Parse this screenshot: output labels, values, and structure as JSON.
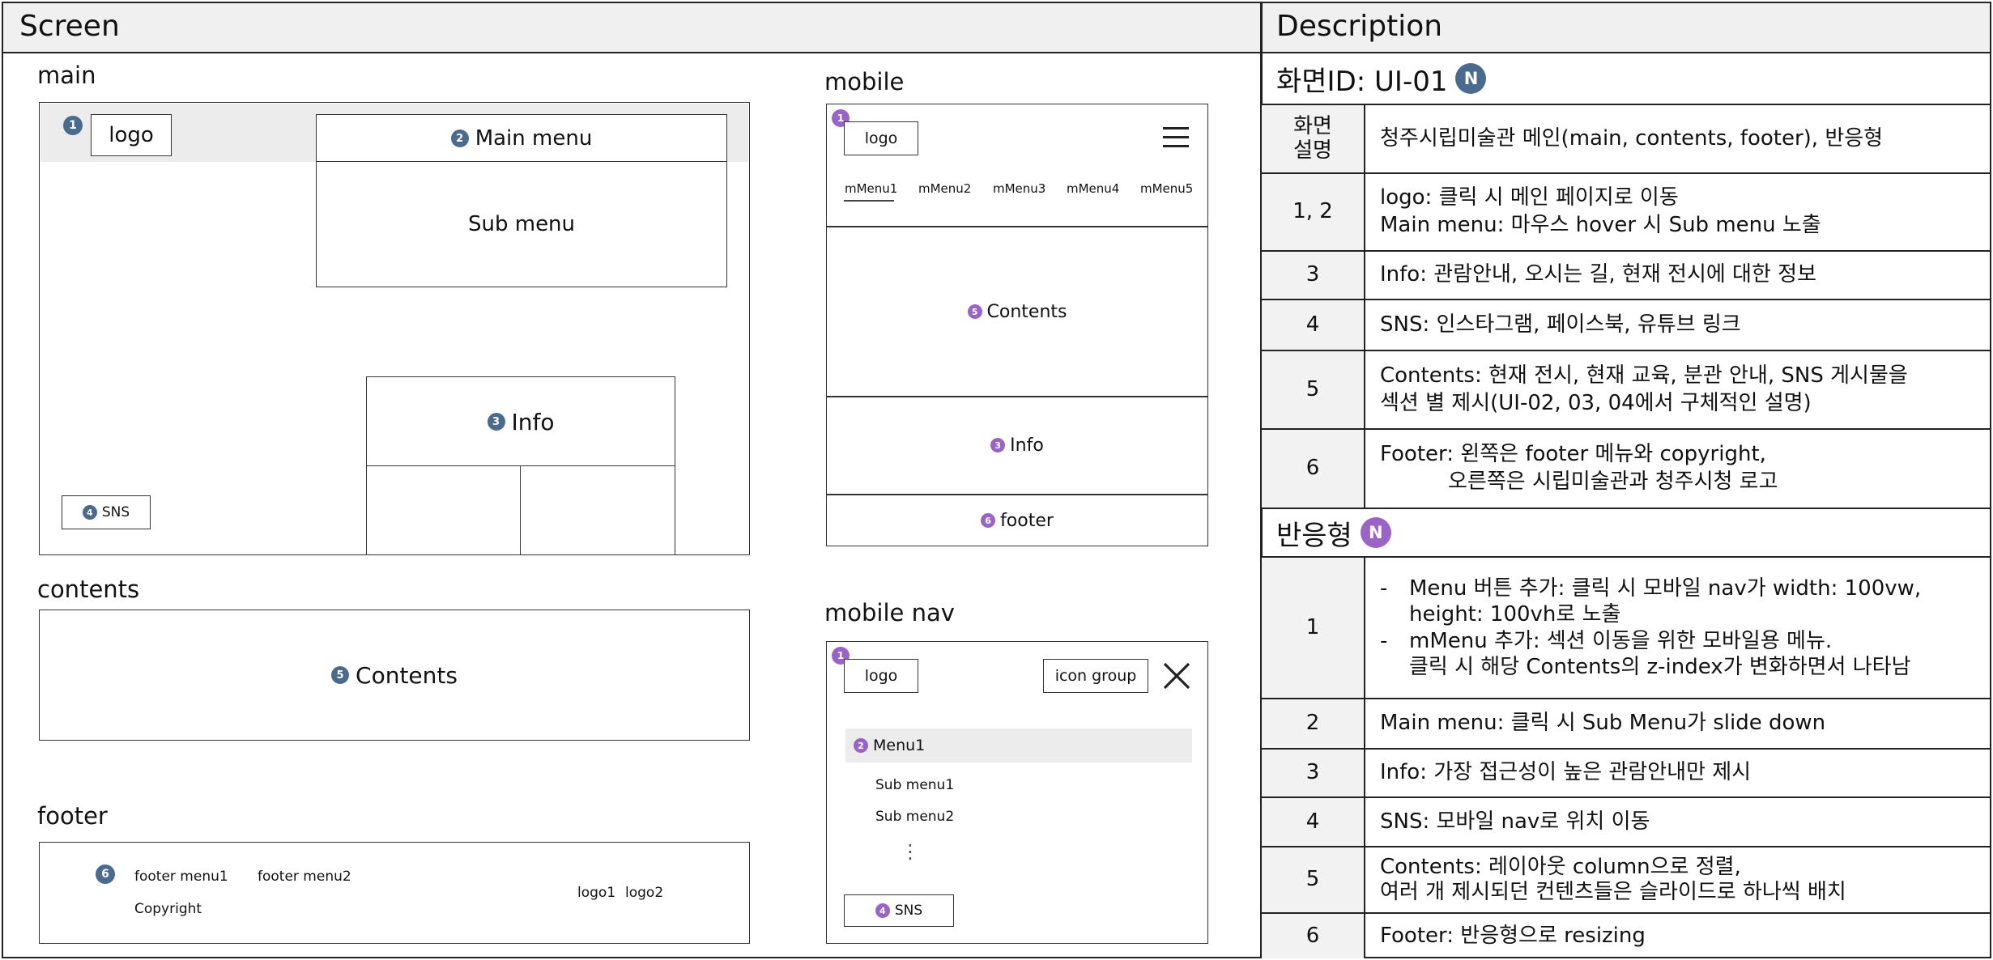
{
  "headers": {
    "screen": "Screen",
    "description": "Description"
  },
  "main": {
    "label": "main",
    "logo": "logo",
    "main_menu": "Main menu",
    "sub_menu": "Sub menu",
    "info": "Info",
    "sns": "SNS",
    "n1": "1",
    "n2": "2",
    "n3": "3",
    "n4": "4"
  },
  "contents": {
    "label": "contents",
    "text": "Contents",
    "n5": "5"
  },
  "footer": {
    "label": "footer",
    "menu1": "footer menu1",
    "menu2": "footer menu2",
    "copyright": "Copyright",
    "logo1": "logo1",
    "logo2": "logo2",
    "n6": "6"
  },
  "mobile": {
    "label": "mobile",
    "logo": "logo",
    "menus": [
      "mMenu1",
      "mMenu2",
      "mMenu3",
      "mMenu4",
      "mMenu5"
    ],
    "contents": "Contents",
    "info": "Info",
    "footer": "footer",
    "n1": "1",
    "n5": "5",
    "n3": "3",
    "n6": "6"
  },
  "mobile_nav": {
    "label": "mobile nav",
    "logo": "logo",
    "icon_group": "icon group",
    "menu1": "Menu1",
    "sub1": "Sub menu1",
    "sub2": "Sub menu2",
    "ellipsis": "⋮",
    "sns": "SNS",
    "n1": "1",
    "n2": "2",
    "n4": "4"
  },
  "description": {
    "screen_id": "화면ID: UI-01",
    "badge": "N",
    "rows": [
      {
        "key": "화면\n설명",
        "lines": [
          "청주시립미술관 메인(main, contents, footer), 반응형"
        ]
      },
      {
        "key": "1, 2",
        "lines": [
          "logo: 클릭 시 메인 페이지로 이동",
          "Main menu: 마우스 hover 시 Sub menu 노출"
        ]
      },
      {
        "key": "3",
        "lines": [
          "Info: 관람안내, 오시는 길, 현재 전시에 대한 정보"
        ]
      },
      {
        "key": "4",
        "lines": [
          "SNS: 인스타그램, 페이스북, 유튜브 링크"
        ]
      },
      {
        "key": "5",
        "lines": [
          "Contents: 현재 전시, 현재 교육, 분관 안내, SNS 게시물을",
          "섹션 별 제시(UI-02, 03, 04에서 구체적인 설명)"
        ]
      },
      {
        "key": "6",
        "lines": [
          "Footer: 왼쪽은 footer 메뉴와 copyright,",
          "오른쪽은 시립미술관과 청주시청 로고"
        ]
      }
    ],
    "responsive_title": "반응형",
    "responsive_rows": [
      {
        "key": "1",
        "items": [
          {
            "dash": "-",
            "lines": [
              "Menu 버튼 추가: 클릭 시 모바일 nav가 width: 100vw,",
              "height: 100vh로 노출"
            ]
          },
          {
            "dash": "-",
            "lines": [
              "mMenu 추가: 섹션 이동을 위한 모바일용 메뉴.",
              "클릭 시 해당 Contents의 z-index가 변화하면서 나타남"
            ]
          }
        ]
      },
      {
        "key": "2",
        "lines": [
          "Main menu: 클릭 시 Sub Menu가 slide down"
        ]
      },
      {
        "key": "3",
        "lines": [
          "Info: 가장 접근성이 높은 관람안내만 제시"
        ]
      },
      {
        "key": "4",
        "lines": [
          "SNS: 모바일 nav로 위치 이동"
        ]
      },
      {
        "key": "5",
        "lines": [
          "Contents: 레이아웃 column으로 정렬,",
          "여러 개 제시되던 컨텐츠들은 슬라이드로 하나씩 배치"
        ]
      },
      {
        "key": "6",
        "lines": [
          "Footer: 반응형으로 resizing"
        ]
      }
    ]
  }
}
